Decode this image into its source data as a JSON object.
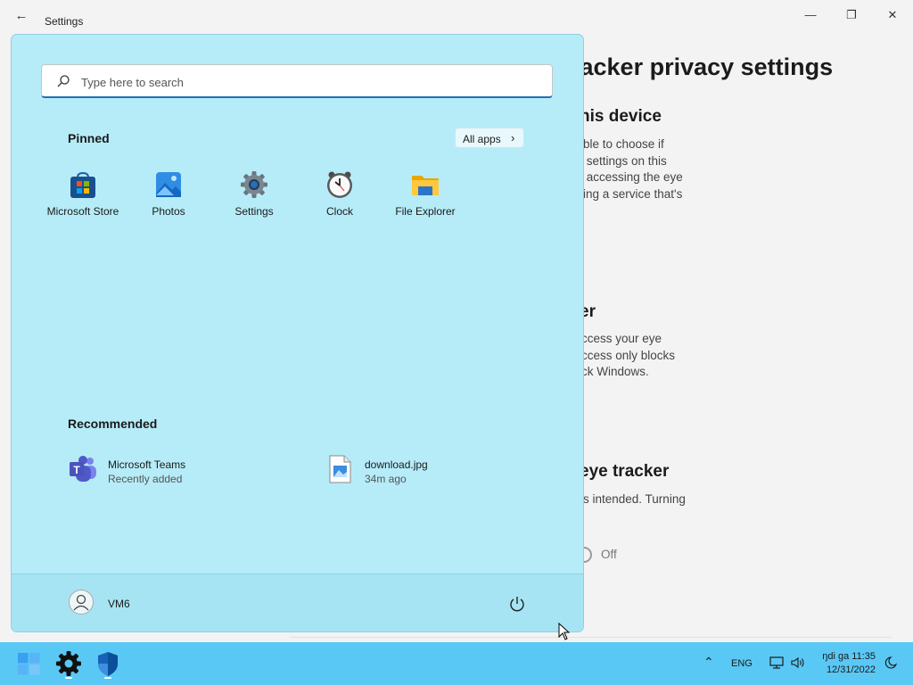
{
  "window": {
    "title": "Settings"
  },
  "background_page": {
    "heading": "racker privacy settings",
    "section1_title": "his device",
    "section1_lines": [
      "ble to choose if",
      " settings on this",
      " accessing the eye",
      "ing a service that's"
    ],
    "section2_title": "er",
    "section2_lines": [
      "ccess your eye",
      "ccess only blocks",
      "ck Windows."
    ],
    "section3_title": "eye tracker",
    "section3_line": "s intended. Turning",
    "toggle_label": "Off"
  },
  "start_menu": {
    "search_placeholder": "Type here to search",
    "pinned_title": "Pinned",
    "all_apps_label": "All apps",
    "pinned_apps": [
      {
        "label": "Microsoft Store",
        "icon": "microsoft-store-icon"
      },
      {
        "label": "Photos",
        "icon": "photos-icon"
      },
      {
        "label": "Settings",
        "icon": "gear-icon"
      },
      {
        "label": "Clock",
        "icon": "clock-icon"
      },
      {
        "label": "File Explorer",
        "icon": "folder-icon"
      }
    ],
    "recommended_title": "Recommended",
    "recommended": [
      {
        "name": "Microsoft Teams",
        "subtitle": "Recently added",
        "icon": "teams-icon"
      },
      {
        "name": "download.jpg",
        "subtitle": "34m ago",
        "icon": "image-file-icon"
      }
    ],
    "user": {
      "name": "VM6"
    }
  },
  "taskbar": {
    "language": "ENG",
    "time": "ŋdi ga 11:35",
    "date": "12/31/2022"
  },
  "colors": {
    "start_menu_bg": "#b6ecf8",
    "taskbar_bg": "#5ac8f5",
    "accent": "#1f6fb8"
  }
}
